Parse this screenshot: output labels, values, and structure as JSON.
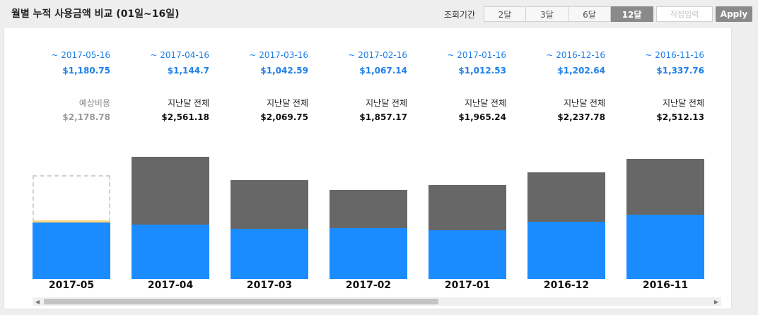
{
  "header": {
    "title": "월별 누적 사용금액 비교 (01일~16일)"
  },
  "toolbar": {
    "period_label": "조회기간",
    "periods": [
      {
        "label": "2달",
        "active": false
      },
      {
        "label": "3달",
        "active": false
      },
      {
        "label": "6달",
        "active": false
      },
      {
        "label": "12달",
        "active": true
      }
    ],
    "custom_placeholder": "직접입력",
    "apply_label": "Apply"
  },
  "colors": {
    "accent_blue": "#1a8cff",
    "prev_gray": "#676767",
    "estimate_yellow": "#ffd77a",
    "button_gray": "#8a8a8a"
  },
  "chart_data": {
    "type": "bar",
    "stacked": true,
    "ylim": [
      0,
      2600
    ],
    "categories": [
      "2017-05",
      "2017-04",
      "2017-03",
      "2017-02",
      "2017-01",
      "2016-12",
      "2016-11"
    ],
    "ranges": [
      "~ 2017-05-16",
      "~ 2017-04-16",
      "~ 2017-03-16",
      "~ 2017-02-16",
      "~ 2017-01-16",
      "~ 2016-12-16",
      "~ 2016-11-16"
    ],
    "current_values": [
      1180.75,
      1144.7,
      1042.59,
      1067.14,
      1012.53,
      1202.64,
      1337.76
    ],
    "current_labels": [
      "$1,180.75",
      "$1,144.7",
      "$1,042.59",
      "$1,067.14",
      "$1,012.53",
      "$1,202.64",
      "$1,337.76"
    ],
    "total_values": [
      2178.78,
      2561.18,
      2069.75,
      1857.17,
      1965.24,
      2237.78,
      2512.13
    ],
    "total_labels": [
      "$2,178.78",
      "$2,561.18",
      "$2,069.75",
      "$1,857.17",
      "$1,965.24",
      "$2,237.78",
      "$2,512.13"
    ],
    "ref_labels": [
      "예상비용",
      "지난달 전체",
      "지난달 전체",
      "지난달 전체",
      "지난달 전체",
      "지난달 전체",
      "지난달 전체"
    ],
    "estimated": [
      true,
      false,
      false,
      false,
      false,
      false,
      false
    ],
    "estimate_extra": [
      50,
      0,
      0,
      0,
      0,
      0,
      0
    ]
  }
}
